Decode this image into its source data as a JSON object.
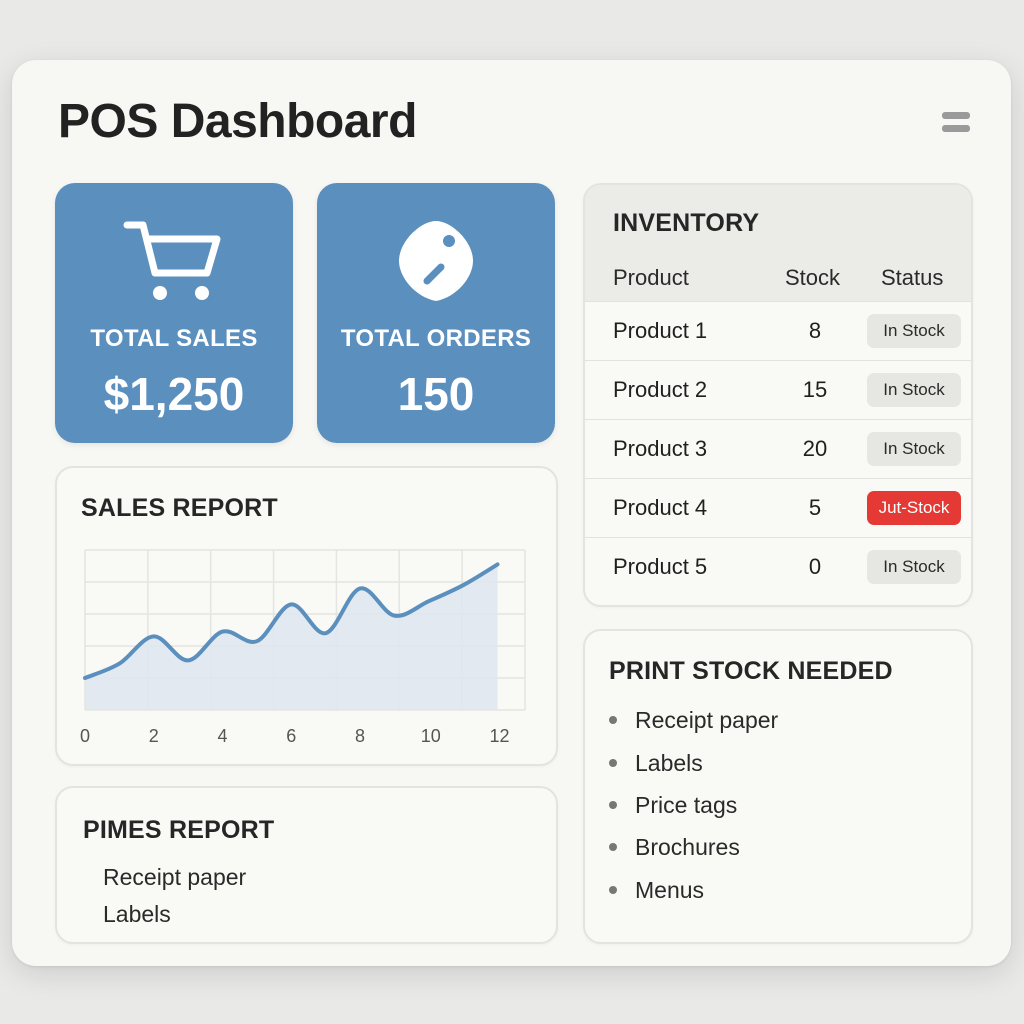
{
  "app": {
    "title": "POS Dashboard"
  },
  "stats": [
    {
      "label": "TOTAL SALES",
      "value": "$1,250",
      "icon": "shopping-cart-icon"
    },
    {
      "label": "TOTAL ORDERS",
      "value": "150",
      "icon": "price-tag-icon"
    }
  ],
  "inventory": {
    "title": "INVENTORY",
    "columns": [
      "Product",
      "Stock",
      "Status"
    ],
    "rows": [
      {
        "product": "Product 1",
        "stock": "8",
        "status": "In Stock"
      },
      {
        "product": "Product 2",
        "stock": "15",
        "status": "In Stock"
      },
      {
        "product": "Product 3",
        "stock": "20",
        "status": "In Stock"
      },
      {
        "product": "Product 4",
        "stock": "5",
        "status": "Jut-Stock"
      },
      {
        "product": "Product 5",
        "stock": "0",
        "status": "In Stock"
      }
    ]
  },
  "sales_report": {
    "title": "SALES REPORT"
  },
  "chart_data": {
    "type": "area",
    "x": [
      0,
      1,
      2,
      3,
      4,
      5,
      6,
      7,
      8,
      9,
      10,
      11,
      12
    ],
    "values": [
      20,
      29,
      46,
      31,
      49,
      43,
      66,
      48,
      76,
      59,
      68,
      78,
      91
    ],
    "x_ticks": [
      "0",
      "2",
      "4",
      "6",
      "8",
      "10",
      "12"
    ],
    "xlim": [
      0,
      12.8
    ],
    "ylim": [
      0,
      100
    ],
    "grid": true,
    "colors": {
      "line": "#5b8fbe",
      "fill": "#dfe7ef"
    }
  },
  "pimes_report": {
    "title": "PIMES REPORT",
    "items": [
      "Receipt paper",
      "Labels"
    ]
  },
  "print_stock": {
    "title": "PRINT STOCK NEEDED",
    "items": [
      "Receipt paper",
      "Labels",
      "Price tags",
      "Brochures",
      "Menus"
    ]
  },
  "colors": {
    "accent": "#5b8fbe",
    "danger": "#e53935"
  }
}
